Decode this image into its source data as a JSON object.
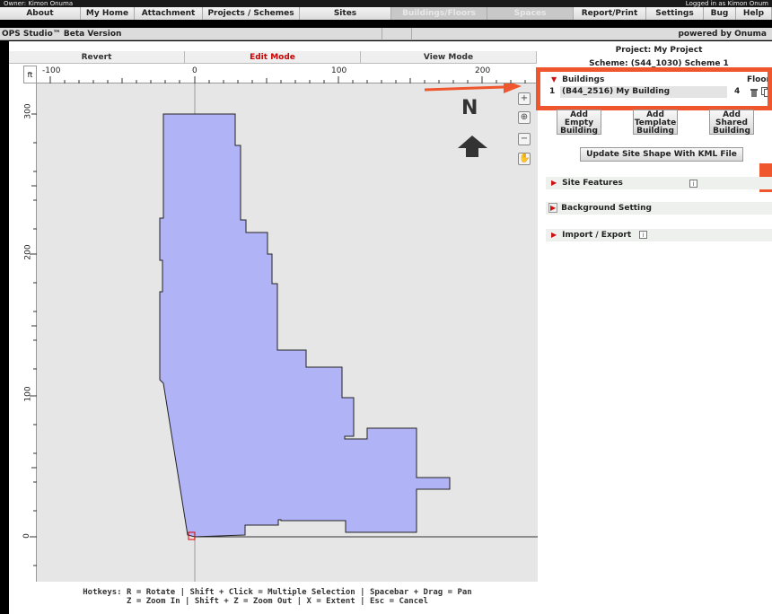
{
  "top": {
    "owner": "Owner: Kimon Onuma",
    "logged_in": "Logged in as Kimon Onum"
  },
  "menu": {
    "items": [
      {
        "label": "About"
      },
      {
        "label": "My Home"
      },
      {
        "label": "Attachment"
      },
      {
        "label": "Projects / Schemes"
      },
      {
        "label": "Sites"
      },
      {
        "label": "Buildings/Floors"
      },
      {
        "label": "Spaces"
      },
      {
        "label": "Report/Print"
      },
      {
        "label": "Settings"
      },
      {
        "label": "Bug"
      },
      {
        "label": "Help"
      }
    ]
  },
  "titlebar": {
    "left": "OPS Studio™ Beta Version",
    "right": "powered by Onuma"
  },
  "modes": {
    "revert": "Revert",
    "edit": "Edit Mode",
    "view": "View Mode"
  },
  "ruler": {
    "unit": "ft",
    "x_ticks": [
      "-100",
      "0",
      "100",
      "200"
    ],
    "y_ticks": [
      "300",
      "200",
      "100",
      "0"
    ]
  },
  "canvas": {
    "north_label": "N",
    "zoom_in": "+",
    "zoom_extent": "⊕",
    "zoom_out": "−",
    "pan": "✋"
  },
  "hotkeys": {
    "line1": "Hotkeys: R = Rotate | Shift + Click = Multiple Selection | Spacebar + Drag = Pan",
    "line2": "Z = Zoom In | Shift + Z = Zoom Out | X = Extent | Esc = Cancel"
  },
  "right": {
    "project_title": "Project: My Project",
    "scheme_title": "Scheme: (S44_1030) Scheme 1",
    "buildings_label": "Buildings",
    "floors_label": "Floor",
    "building_row": {
      "index": "1",
      "name": "(B44_2516) My Building",
      "floors": "4"
    },
    "add_empty": "Add Empty Building",
    "add_template": "Add Template Building",
    "add_shared": "Add Shared Building",
    "kml_button": "Update Site Shape With KML File",
    "site_features": "Site Features",
    "background_setting": "Background Setting",
    "import_export": "Import / Export",
    "info": "i"
  },
  "colors": {
    "accent_orange": "#f0562d",
    "building_fill": "#b0b3f5",
    "edit_red": "#cc0000"
  }
}
